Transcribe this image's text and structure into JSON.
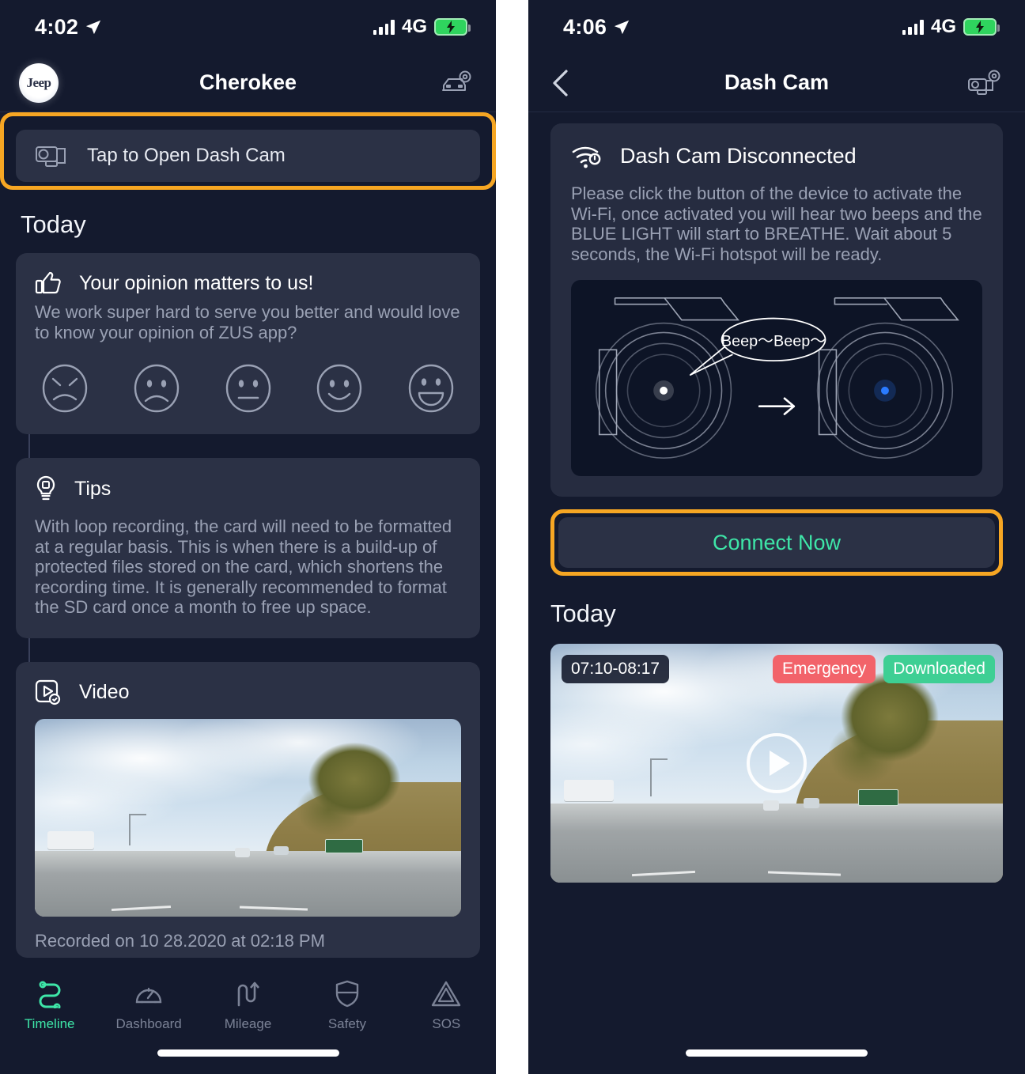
{
  "left": {
    "status_bar": {
      "time": "4:02",
      "network": "4G",
      "location_icon": "location-arrow-icon",
      "signal_icon": "signal-bars-icon",
      "battery_icon": "battery-charging-icon"
    },
    "nav": {
      "title": "Cherokee",
      "logo_text": "Jeep",
      "settings_icon": "car-settings-icon"
    },
    "dashcam_bar": {
      "label": "Tap to Open Dash Cam",
      "icon": "dashcam-icon",
      "highlighted": true
    },
    "section_title": "Today",
    "cards": [
      {
        "icon": "thumbs-up-icon",
        "title": "Your opinion matters to us!",
        "body": "We work super hard to serve you better and would love to know your opinion of ZUS app?",
        "ratings": [
          "angry-face-icon",
          "sad-face-icon",
          "neutral-face-icon",
          "smile-face-icon",
          "happy-face-icon"
        ]
      },
      {
        "icon": "lightbulb-icon",
        "title": "Tips",
        "body": "With loop recording, the card will need to be formatted at a regular basis. This is when there is a build-up of protected files stored on the card, which shortens the recording time. It is generally recommended to format the SD card once a month to free up space."
      },
      {
        "icon": "video-icon",
        "title": "Video",
        "caption": "Recorded on 10 28.2020 at 02:18 PM"
      }
    ],
    "tabs": [
      {
        "label": "Timeline",
        "icon": "timeline-icon",
        "active": true
      },
      {
        "label": "Dashboard",
        "icon": "gauge-icon",
        "active": false
      },
      {
        "label": "Mileage",
        "icon": "mileage-road-icon",
        "active": false
      },
      {
        "label": "Safety",
        "icon": "shield-icon",
        "active": false
      },
      {
        "label": "SOS",
        "icon": "warning-triangle-icon",
        "active": false
      }
    ]
  },
  "right": {
    "status_bar": {
      "time": "4:06",
      "network": "4G",
      "location_icon": "location-arrow-icon",
      "signal_icon": "signal-bars-icon",
      "battery_icon": "battery-charging-icon"
    },
    "nav": {
      "title": "Dash Cam",
      "back_icon": "chevron-left-icon",
      "settings_icon": "dashcam-settings-icon"
    },
    "status_panel": {
      "icon": "wifi-off-icon",
      "title": "Dash Cam Disconnected",
      "text": "Please click the button of the device to activate the Wi-Fi, once activated you will hear two beeps and the BLUE LIGHT will start to BREATHE. Wait about 5 seconds, the Wi-Fi hotspot will be ready.",
      "diagram": {
        "speech_bubble": "Beep～Beep～",
        "arrow_icon": "arrow-right-icon",
        "led_left": "#ffffff",
        "led_right": "#2b7bff"
      }
    },
    "connect_button": {
      "label": "Connect Now",
      "highlighted": true
    },
    "section_title": "Today",
    "video": {
      "time_range": "07:10-08:17",
      "badges": [
        {
          "label": "Emergency",
          "color": "#f2636a"
        },
        {
          "label": "Downloaded",
          "color": "#3ecf94"
        }
      ],
      "play_icon": "play-circle-icon"
    }
  },
  "colors": {
    "background": "#141a2e",
    "card": "#2b3145",
    "panel": "#262c40",
    "accent_green": "#3ee6a8",
    "highlight_orange": "#f6a623",
    "muted_text": "#9aa1b4"
  }
}
